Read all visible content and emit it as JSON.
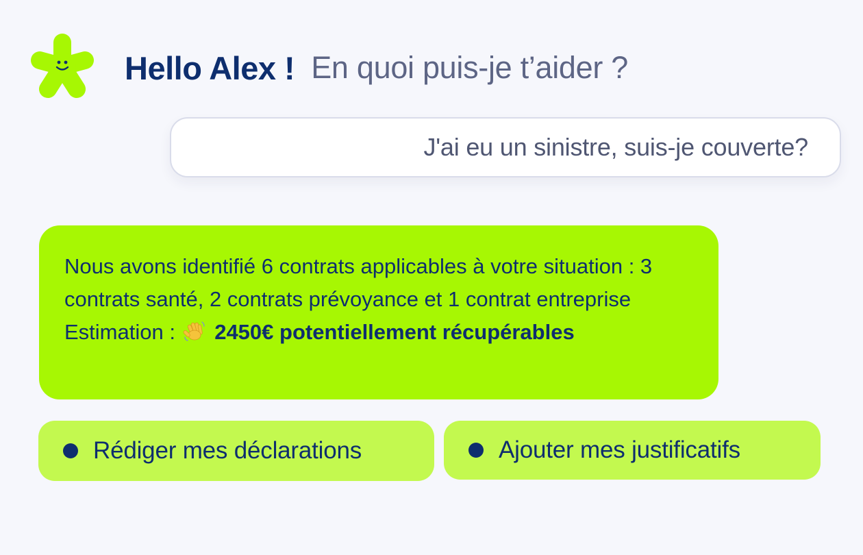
{
  "colors": {
    "background": "#f6f7fc",
    "brand_green": "#a7f703",
    "action_green": "#c3f94f",
    "navy": "#0e2e6e",
    "muted_text": "#5d6585"
  },
  "header": {
    "mascot_icon": "smiling-flower-icon",
    "name": "Hello Alex !",
    "subtitle": "En quoi puis-je t’aider ?"
  },
  "user_message": {
    "text": "J'ai eu un sinistre, suis-je couverte?"
  },
  "assistant_message": {
    "text": "Nous avons identifié 6 contrats applicables à votre situation : 3 contrats santé, 2 contrats prévoyance et 1 contrat entreprise",
    "estimate_label": "Estimation :",
    "estimate_icon": "waving-hand-icon",
    "estimate_amount": "2450€ potentiellement récupérables"
  },
  "actions": [
    {
      "label": "Rédiger mes déclarations"
    },
    {
      "label": "Ajouter mes justificatifs"
    }
  ]
}
